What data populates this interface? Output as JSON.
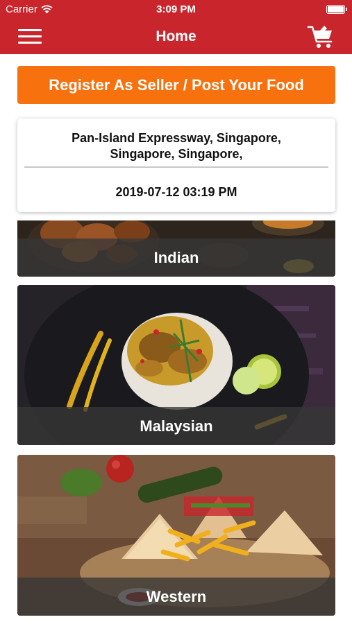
{
  "status_bar": {
    "carrier": "Carrier",
    "time": "3:09 PM"
  },
  "nav": {
    "title": "Home",
    "menu_icon": "hamburger-menu-icon",
    "cart_icon": "shopping-cart-icon"
  },
  "register_button": {
    "label": "Register As Seller / Post Your Food"
  },
  "info_card": {
    "address_line1": "Pan-Island Expressway, Singapore,",
    "address_line2": "Singapore, Singapore,",
    "datetime": "2019-07-12 03:19 PM"
  },
  "categories": [
    {
      "label": "Indian"
    },
    {
      "label": "Malaysian"
    },
    {
      "label": "Western"
    }
  ],
  "colors": {
    "header_red": "#c8262c",
    "accent_orange": "#f7710e",
    "label_overlay": "#373737"
  }
}
